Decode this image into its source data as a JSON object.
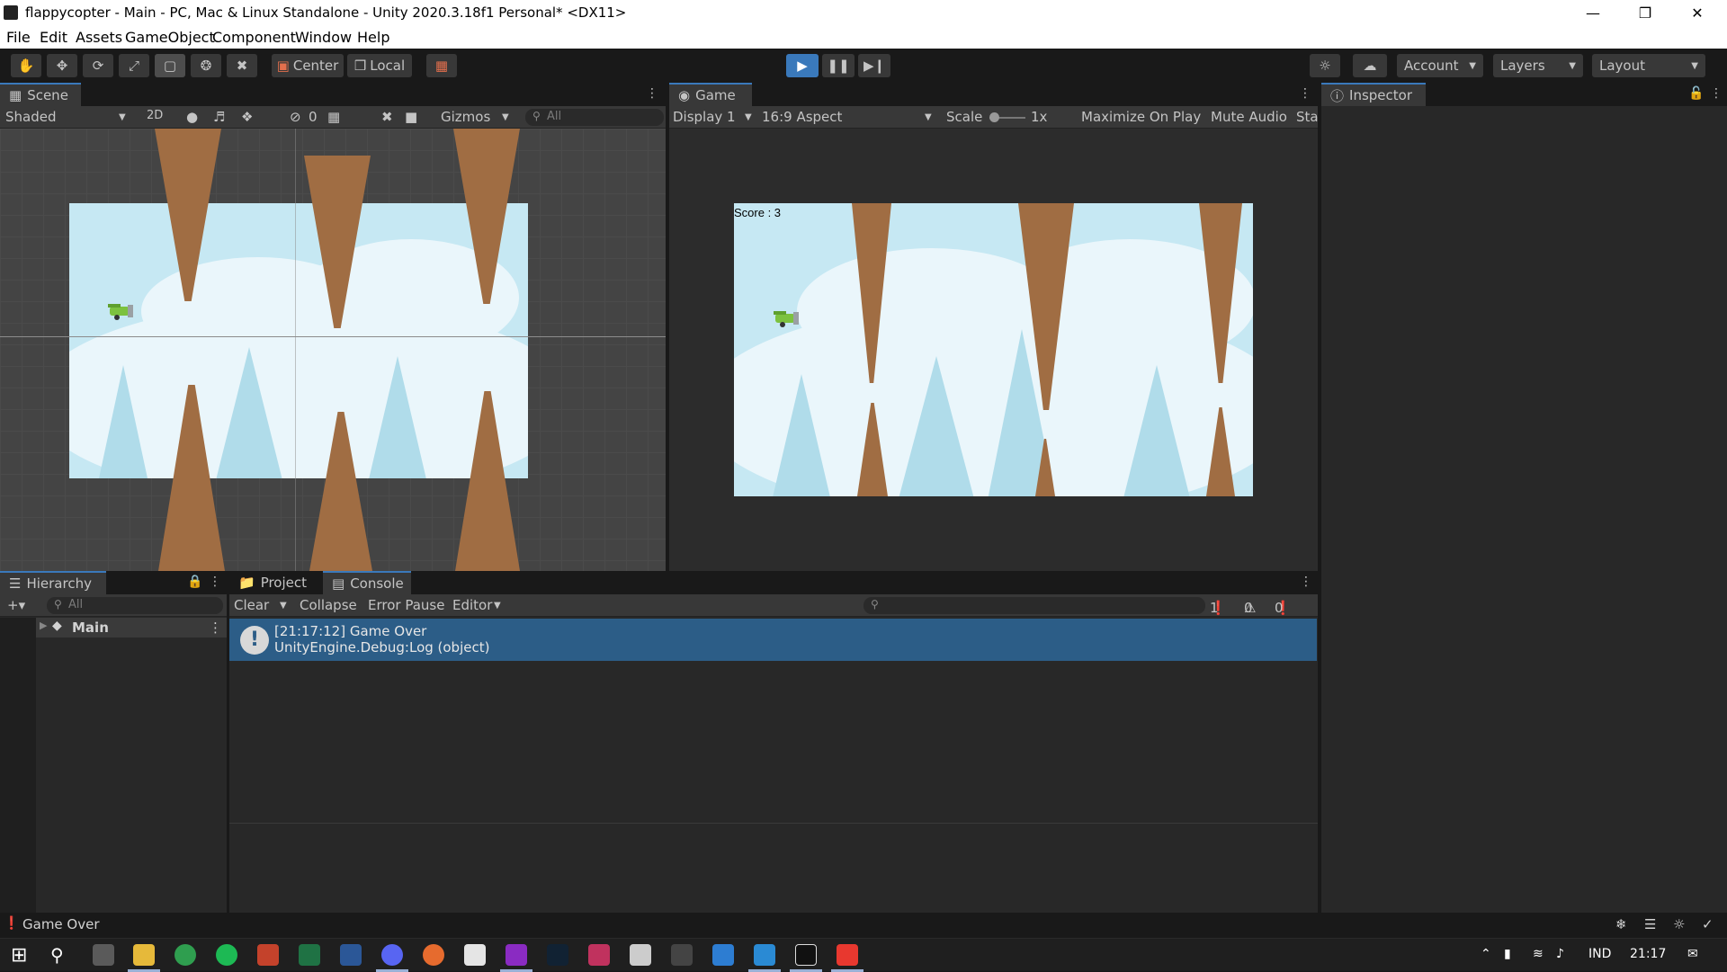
{
  "window": {
    "title": "flappycopter - Main - PC, Mac & Linux Standalone - Unity 2020.3.18f1 Personal* <DX11>"
  },
  "menu": [
    "File",
    "Edit",
    "Assets",
    "GameObject",
    "Component",
    "Window",
    "Help"
  ],
  "toolbar": {
    "pivot": "Center",
    "space": "Local",
    "account": "Account",
    "layers": "Layers",
    "layout": "Layout"
  },
  "scene": {
    "tab": "Scene",
    "shading": "Shaded",
    "mode2d": "2D",
    "hidden_count": "0",
    "gizmos": "Gizmos",
    "search_placeholder": "All"
  },
  "game": {
    "tab": "Game",
    "display": "Display 1",
    "aspect": "16:9 Aspect",
    "scale_label": "Scale",
    "scale_value": "1x",
    "maximize": "Maximize On Play",
    "mute": "Mute Audio",
    "stats": "Sta",
    "score_text": "Score : 3"
  },
  "inspector": {
    "tab": "Inspector"
  },
  "hierarchy": {
    "tab": "Hierarchy",
    "search_placeholder": "All",
    "items": [
      {
        "label": "Main"
      }
    ]
  },
  "bottom_tabs": {
    "project": "Project",
    "console": "Console"
  },
  "console": {
    "clear": "Clear",
    "collapse": "Collapse",
    "error_pause": "Error Pause",
    "editor": "Editor",
    "log_count": "1",
    "warn_count": "0",
    "error_count": "0",
    "entries": [
      {
        "line1": "[21:17:12] Game Over",
        "line2": "UnityEngine.Debug:Log (object)"
      }
    ]
  },
  "status": {
    "message": "Game Over"
  },
  "taskbar": {
    "lang": "IND",
    "time": "21:17"
  },
  "colors": {
    "accent": "#3a79bb",
    "selection": "#2c5d87",
    "spike": "#a06d43",
    "sky": "#c6e8f3"
  }
}
